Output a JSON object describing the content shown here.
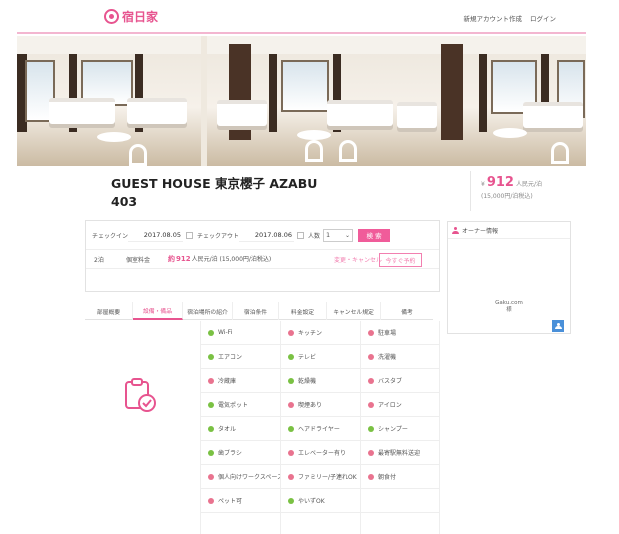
{
  "header": {
    "logo_text": "宿日家",
    "links": [
      "新規アカウント作成",
      "ログイン"
    ]
  },
  "listing": {
    "title_line1": "GUEST HOUSE 東京櫻子 AZABU",
    "title_line2": "403",
    "price_prefix": "¥",
    "price_value": "912",
    "price_unit": "人民元/泊",
    "price_sub": "(15,000円/泊税込)"
  },
  "search": {
    "checkin_label": "チェックイン",
    "checkin_value": "2017.08.05",
    "checkout_label": "チェックアウト",
    "checkout_value": "2017.08.06",
    "guests_label": "人数",
    "guests_value": "1",
    "search_button": "検 索"
  },
  "plan": {
    "count": "2泊",
    "room_type": "個室料金",
    "price_prefix": "約",
    "price_value": "912",
    "price_detail": "人民元/泊 (15,000円/泊税込)",
    "link_label": "変更・キャンセル",
    "reserve_button": "今すぐ予約"
  },
  "owner": {
    "heading": "オーナー情報",
    "name_line1": "Gaku.com",
    "name_line2": "様"
  },
  "tabs": [
    "部屋概要",
    "設備・備品",
    "宿泊場所の紹介",
    "宿泊条件",
    "料金設定",
    "キャンセル規定",
    "備考"
  ],
  "amenities": [
    {
      "label": "Wi-Fi",
      "available": true
    },
    {
      "label": "キッチン",
      "available": false
    },
    {
      "label": "駐車場",
      "available": false
    },
    {
      "label": "エアコン",
      "available": true
    },
    {
      "label": "テレビ",
      "available": true
    },
    {
      "label": "洗濯機",
      "available": false
    },
    {
      "label": "冷蔵庫",
      "available": false
    },
    {
      "label": "乾燥機",
      "available": true
    },
    {
      "label": "バスタブ",
      "available": false
    },
    {
      "label": "電気ポット",
      "available": true
    },
    {
      "label": "喫煙あり",
      "available": false
    },
    {
      "label": "アイロン",
      "available": false
    },
    {
      "label": "タオル",
      "available": true
    },
    {
      "label": "ヘアドライヤー",
      "available": true
    },
    {
      "label": "シャンプー",
      "available": true
    },
    {
      "label": "歯ブラシ",
      "available": true
    },
    {
      "label": "エレベーター有り",
      "available": false
    },
    {
      "label": "最寄駅無料送迎",
      "available": false
    },
    {
      "label": "個人向けワークスペース",
      "available": false
    },
    {
      "label": "ファミリー/子連れOK",
      "available": false
    },
    {
      "label": "朝食付",
      "available": false
    },
    {
      "label": "ペット可",
      "available": false
    },
    {
      "label": "やいずOK",
      "available": true
    }
  ],
  "colors": {
    "accent": "#e7548f",
    "available": "#7ac143",
    "unavailable": "#e9738f"
  }
}
